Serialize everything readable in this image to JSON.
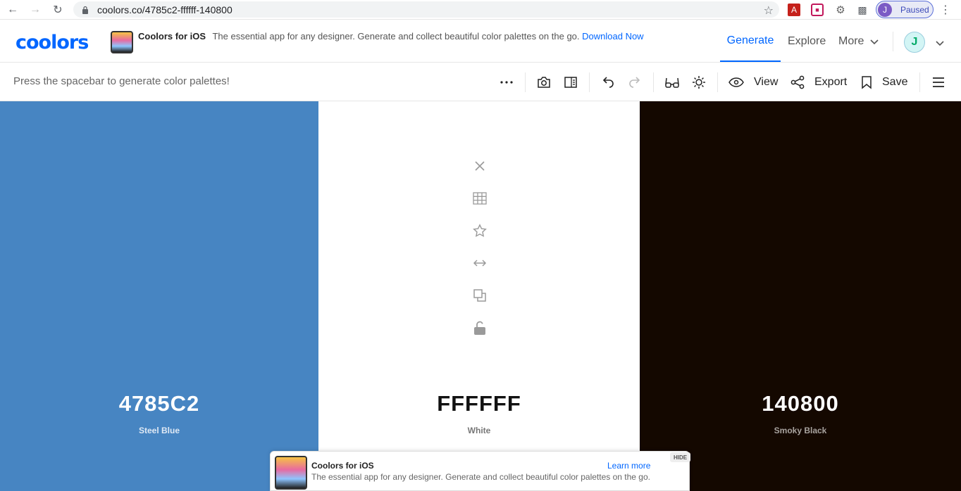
{
  "browser": {
    "url": "coolors.co/4785c2-ffffff-140800",
    "profile_initial": "J",
    "profile_status": "Paused"
  },
  "header": {
    "logo": "coolors",
    "promo": {
      "title": "Coolors for iOS",
      "description": "The essential app for any designer. Generate and collect beautiful color palettes on the go.",
      "link": "Download Now"
    },
    "nav": [
      "Generate",
      "Explore",
      "More"
    ],
    "user_initial": "J"
  },
  "toolbar": {
    "hint": "Press the spacebar to generate color palettes!",
    "view_label": "View",
    "export_label": "Export",
    "save_label": "Save"
  },
  "palette": {
    "colors": [
      {
        "hex": "4785C2",
        "name": "Steel Blue",
        "bg": "#4785c2",
        "text": "#ffffff",
        "subtext": "#dfe9f5"
      },
      {
        "hex": "FFFFFF",
        "name": "White",
        "bg": "#ffffff",
        "text": "#111111",
        "subtext": "#777777"
      },
      {
        "hex": "140800",
        "name": "Smoky Black",
        "bg": "#140800",
        "text": "#ffffff",
        "subtext": "#a8a39f"
      }
    ]
  },
  "banner": {
    "title": "Coolors for iOS",
    "description": "The essential app for any designer. Generate and collect beautiful color palettes on the go.",
    "link": "Learn more",
    "hide": "HIDE"
  },
  "colors": {
    "accent": "#0066ff"
  }
}
